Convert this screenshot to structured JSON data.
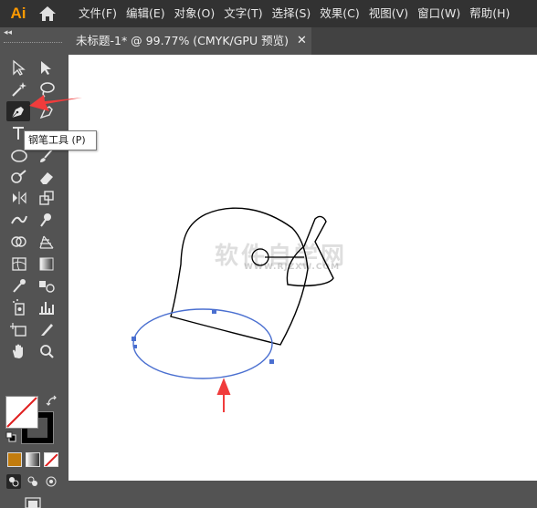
{
  "app": {
    "logo": "Ai",
    "accent_color": "#ff9a00"
  },
  "menu": {
    "items": [
      "文件(F)",
      "编辑(E)",
      "对象(O)",
      "文字(T)",
      "选择(S)",
      "效果(C)",
      "视图(V)",
      "窗口(W)",
      "帮助(H)"
    ]
  },
  "document": {
    "tab_title": "未标题-1* @ 99.77% (CMYK/GPU 预览)",
    "close_icon": "close-icon"
  },
  "toolbar": {
    "collapse_glyph": "◂◂",
    "tooltip": "钢笔工具 (P)",
    "active_tool": "pen-tool"
  },
  "canvas": {
    "watermark": "软件自学网",
    "watermark_sub": "WWW.RJZXW.COM",
    "selected_path_color": "#4a6fd0",
    "arrow_color": "#f03c3c"
  }
}
